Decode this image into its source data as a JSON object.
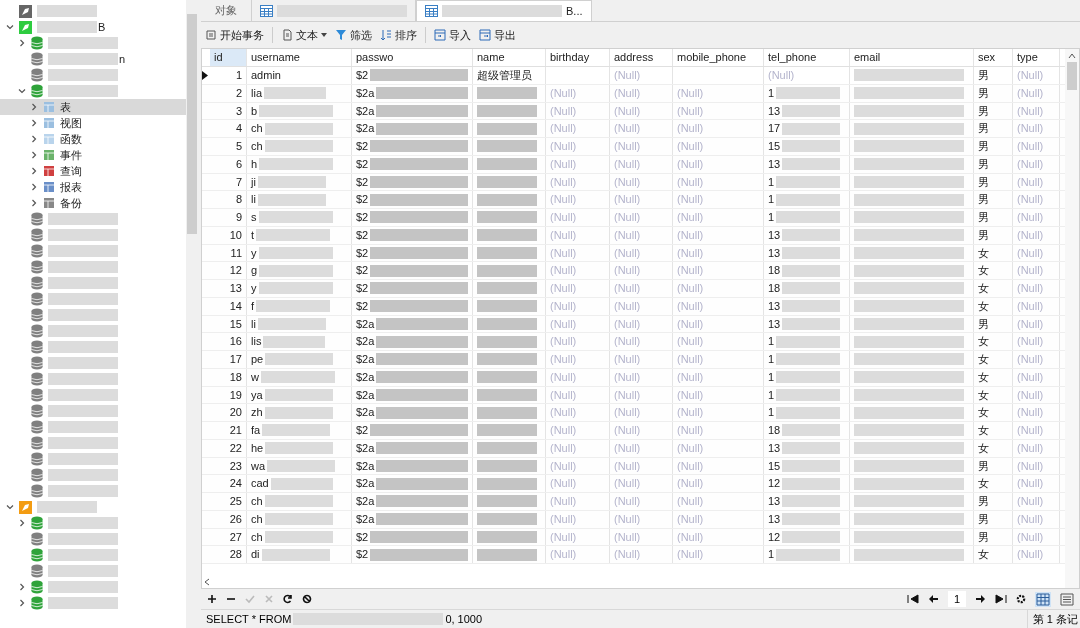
{
  "sidebar": {
    "items": [
      {
        "kind": "connection",
        "open": false
      },
      {
        "kind": "connection",
        "open": true,
        "label": "B",
        "expanded": true,
        "children": [
          {
            "kind": "database",
            "open": true,
            "expanded": false
          },
          {
            "kind": "database",
            "open": false,
            "label": "n"
          },
          {
            "kind": "database",
            "open": false
          },
          {
            "kind": "database",
            "open": true,
            "expanded": true,
            "children": [
              {
                "kind": "tables",
                "label": "表",
                "selected": true
              },
              {
                "kind": "views",
                "label": "视图",
                "selected": false
              },
              {
                "kind": "functions",
                "label": "函数",
                "selected": false
              },
              {
                "kind": "events",
                "label": "事件",
                "selected": false
              },
              {
                "kind": "queries",
                "label": "查询",
                "selected": false
              },
              {
                "kind": "reports",
                "label": "报表",
                "selected": false
              },
              {
                "kind": "backups",
                "label": "备份",
                "selected": false
              }
            ]
          },
          {
            "kind": "database",
            "open": false
          },
          {
            "kind": "database",
            "open": false
          },
          {
            "kind": "database",
            "open": false
          },
          {
            "kind": "database",
            "open": false
          },
          {
            "kind": "database",
            "open": false
          },
          {
            "kind": "database",
            "open": false
          },
          {
            "kind": "database",
            "open": false
          },
          {
            "kind": "database",
            "open": false
          },
          {
            "kind": "database",
            "open": false
          },
          {
            "kind": "database",
            "open": false
          },
          {
            "kind": "database",
            "open": false
          },
          {
            "kind": "database",
            "open": false
          },
          {
            "kind": "database",
            "open": false
          },
          {
            "kind": "database",
            "open": false
          },
          {
            "kind": "database",
            "open": false
          },
          {
            "kind": "database",
            "open": false
          },
          {
            "kind": "database",
            "open": false
          },
          {
            "kind": "database",
            "open": false
          }
        ]
      },
      {
        "kind": "connection",
        "open": true,
        "orange": true,
        "expanded": true,
        "children": [
          {
            "kind": "database",
            "open": true,
            "expanded": false
          },
          {
            "kind": "database",
            "open": false
          },
          {
            "kind": "database",
            "open": true
          },
          {
            "kind": "database",
            "open": false
          },
          {
            "kind": "database",
            "open": true,
            "expanded": false
          },
          {
            "kind": "database",
            "open": true,
            "expanded": false
          }
        ]
      }
    ]
  },
  "tabs": [
    {
      "label": "对象",
      "kind": "objects",
      "selected": false
    },
    {
      "kind": "table",
      "selected": false
    },
    {
      "label": "B...",
      "kind": "table",
      "selected": true
    }
  ],
  "toolbar": [
    {
      "label": "开始事务",
      "kind": "transaction"
    },
    {
      "label": "文本",
      "kind": "text",
      "dropdown": true
    },
    {
      "label": "筛选",
      "kind": "filter"
    },
    {
      "label": "排序",
      "kind": "sort"
    },
    {
      "label": "导入",
      "kind": "import"
    },
    {
      "label": "导出",
      "kind": "export"
    }
  ],
  "table": {
    "columns": [
      "id",
      "username",
      "passwo",
      "name",
      "birthday",
      "address",
      "mobile_phone",
      "tel_phone",
      "email",
      "sex",
      "type"
    ],
    "rows": [
      {
        "id": "1",
        "username": "admin",
        "password": "$2",
        "name": "超级管理员",
        "address": "(Null)",
        "tel_phone": "(Null)",
        "sex": "男",
        "type": "(Null)",
        "selected": true
      },
      {
        "id": "2",
        "username": "lia",
        "password": "$2a",
        "birthday": "(Null)",
        "address": "(Null)",
        "mobile_phone": "(Null)",
        "tel_phone": "1",
        "sex": "男",
        "type": "(Null)",
        "selected": false
      },
      {
        "id": "3",
        "username": "b",
        "password": "$2a",
        "birthday": "(Null)",
        "address": "(Null)",
        "mobile_phone": "(Null)",
        "tel_phone": "13",
        "sex": "男",
        "type": "(Null)",
        "selected": false
      },
      {
        "id": "4",
        "username": "ch",
        "password": "$2a",
        "birthday": "(Null)",
        "address": "(Null)",
        "mobile_phone": "(Null)",
        "tel_phone": "17",
        "sex": "男",
        "type": "(Null)",
        "selected": false
      },
      {
        "id": "5",
        "username": "ch",
        "password": "$2",
        "birthday": "(Null)",
        "address": "(Null)",
        "mobile_phone": "(Null)",
        "tel_phone": "15",
        "sex": "男",
        "type": "(Null)",
        "selected": false
      },
      {
        "id": "6",
        "username": "h",
        "password": "$2",
        "birthday": "(Null)",
        "address": "(Null)",
        "mobile_phone": "(Null)",
        "tel_phone": "13",
        "sex": "男",
        "type": "(Null)",
        "selected": false
      },
      {
        "id": "7",
        "username": "ji",
        "password": "$2",
        "birthday": "(Null)",
        "address": "(Null)",
        "mobile_phone": "(Null)",
        "tel_phone": "1",
        "sex": "男",
        "type": "(Null)",
        "selected": false
      },
      {
        "id": "8",
        "username": "li",
        "password": "$2",
        "birthday": "(Null)",
        "address": "(Null)",
        "mobile_phone": "(Null)",
        "tel_phone": "1",
        "sex": "男",
        "type": "(Null)",
        "selected": false
      },
      {
        "id": "9",
        "username": "s",
        "password": "$2",
        "birthday": "(Null)",
        "address": "(Null)",
        "mobile_phone": "(Null)",
        "tel_phone": "1",
        "sex": "男",
        "type": "(Null)",
        "selected": false
      },
      {
        "id": "10",
        "username": "t",
        "password": "$2",
        "birthday": "(Null)",
        "address": "(Null)",
        "mobile_phone": "(Null)",
        "tel_phone": "13",
        "sex": "男",
        "type": "(Null)",
        "selected": false
      },
      {
        "id": "11",
        "username": "y",
        "password": "$2",
        "birthday": "(Null)",
        "address": "(Null)",
        "mobile_phone": "(Null)",
        "tel_phone": "13",
        "sex": "女",
        "type": "(Null)",
        "selected": false
      },
      {
        "id": "12",
        "username": "g",
        "password": "$2",
        "birthday": "(Null)",
        "address": "(Null)",
        "mobile_phone": "(Null)",
        "tel_phone": "18",
        "sex": "女",
        "type": "(Null)",
        "selected": false
      },
      {
        "id": "13",
        "username": "y",
        "password": "$2",
        "birthday": "(Null)",
        "address": "(Null)",
        "mobile_phone": "(Null)",
        "tel_phone": "18",
        "sex": "女",
        "type": "(Null)",
        "selected": false
      },
      {
        "id": "14",
        "username": "f",
        "password": "$2",
        "birthday": "(Null)",
        "address": "(Null)",
        "mobile_phone": "(Null)",
        "tel_phone": "13",
        "sex": "女",
        "type": "(Null)",
        "selected": false
      },
      {
        "id": "15",
        "username": "li",
        "password": "$2a",
        "birthday": "(Null)",
        "address": "(Null)",
        "mobile_phone": "(Null)",
        "tel_phone": "13",
        "sex": "男",
        "type": "(Null)",
        "selected": false
      },
      {
        "id": "16",
        "username": "lis",
        "password": "$2a",
        "birthday": "(Null)",
        "address": "(Null)",
        "mobile_phone": "(Null)",
        "tel_phone": "1",
        "sex": "女",
        "type": "(Null)",
        "selected": false
      },
      {
        "id": "17",
        "username": "pe",
        "password": "$2a",
        "birthday": "(Null)",
        "address": "(Null)",
        "mobile_phone": "(Null)",
        "tel_phone": "1",
        "sex": "女",
        "type": "(Null)",
        "selected": false
      },
      {
        "id": "18",
        "username": "w",
        "password": "$2a",
        "birthday": "(Null)",
        "address": "(Null)",
        "mobile_phone": "(Null)",
        "tel_phone": "1",
        "sex": "女",
        "type": "(Null)",
        "selected": false
      },
      {
        "id": "19",
        "username": "ya",
        "password": "$2a",
        "birthday": "(Null)",
        "address": "(Null)",
        "mobile_phone": "(Null)",
        "tel_phone": "1",
        "sex": "女",
        "type": "(Null)",
        "selected": false
      },
      {
        "id": "20",
        "username": "zh",
        "password": "$2a",
        "birthday": "(Null)",
        "address": "(Null)",
        "mobile_phone": "(Null)",
        "tel_phone": "1",
        "sex": "女",
        "type": "(Null)",
        "selected": false
      },
      {
        "id": "21",
        "username": "fa",
        "password": "$2",
        "birthday": "(Null)",
        "address": "(Null)",
        "mobile_phone": "(Null)",
        "tel_phone": "18",
        "sex": "女",
        "type": "(Null)",
        "selected": false
      },
      {
        "id": "22",
        "username": "he",
        "password": "$2a",
        "birthday": "(Null)",
        "address": "(Null)",
        "mobile_phone": "(Null)",
        "tel_phone": "13",
        "sex": "女",
        "type": "(Null)",
        "selected": false
      },
      {
        "id": "23",
        "username": "wa",
        "password": "$2a",
        "birthday": "(Null)",
        "address": "(Null)",
        "mobile_phone": "(Null)",
        "tel_phone": "15",
        "sex": "男",
        "type": "(Null)",
        "selected": false
      },
      {
        "id": "24",
        "username": "cad",
        "password": "$2a",
        "birthday": "(Null)",
        "address": "(Null)",
        "mobile_phone": "(Null)",
        "tel_phone": "12",
        "sex": "女",
        "type": "(Null)",
        "selected": false
      },
      {
        "id": "25",
        "username": "ch",
        "password": "$2a",
        "birthday": "(Null)",
        "address": "(Null)",
        "mobile_phone": "(Null)",
        "tel_phone": "13",
        "sex": "男",
        "type": "(Null)",
        "selected": false
      },
      {
        "id": "26",
        "username": "ch",
        "password": "$2a",
        "birthday": "(Null)",
        "address": "(Null)",
        "mobile_phone": "(Null)",
        "tel_phone": "13",
        "sex": "男",
        "type": "(Null)",
        "selected": false
      },
      {
        "id": "27",
        "username": "ch",
        "password": "$2",
        "birthday": "(Null)",
        "address": "(Null)",
        "mobile_phone": "(Null)",
        "tel_phone": "12",
        "sex": "男",
        "type": "(Null)",
        "selected": false
      },
      {
        "id": "28",
        "username": "di",
        "password": "$2",
        "birthday": "(Null)",
        "address": "(Null)",
        "mobile_phone": "(Null)",
        "tel_phone": "1",
        "sex": "女",
        "type": "(Null)",
        "selected": false
      }
    ]
  },
  "pager": {
    "page": "1"
  },
  "status_bar": {
    "sql_start": "SELECT * FROM",
    "sql_end": "0, 1000",
    "record": "第 1 条记"
  }
}
